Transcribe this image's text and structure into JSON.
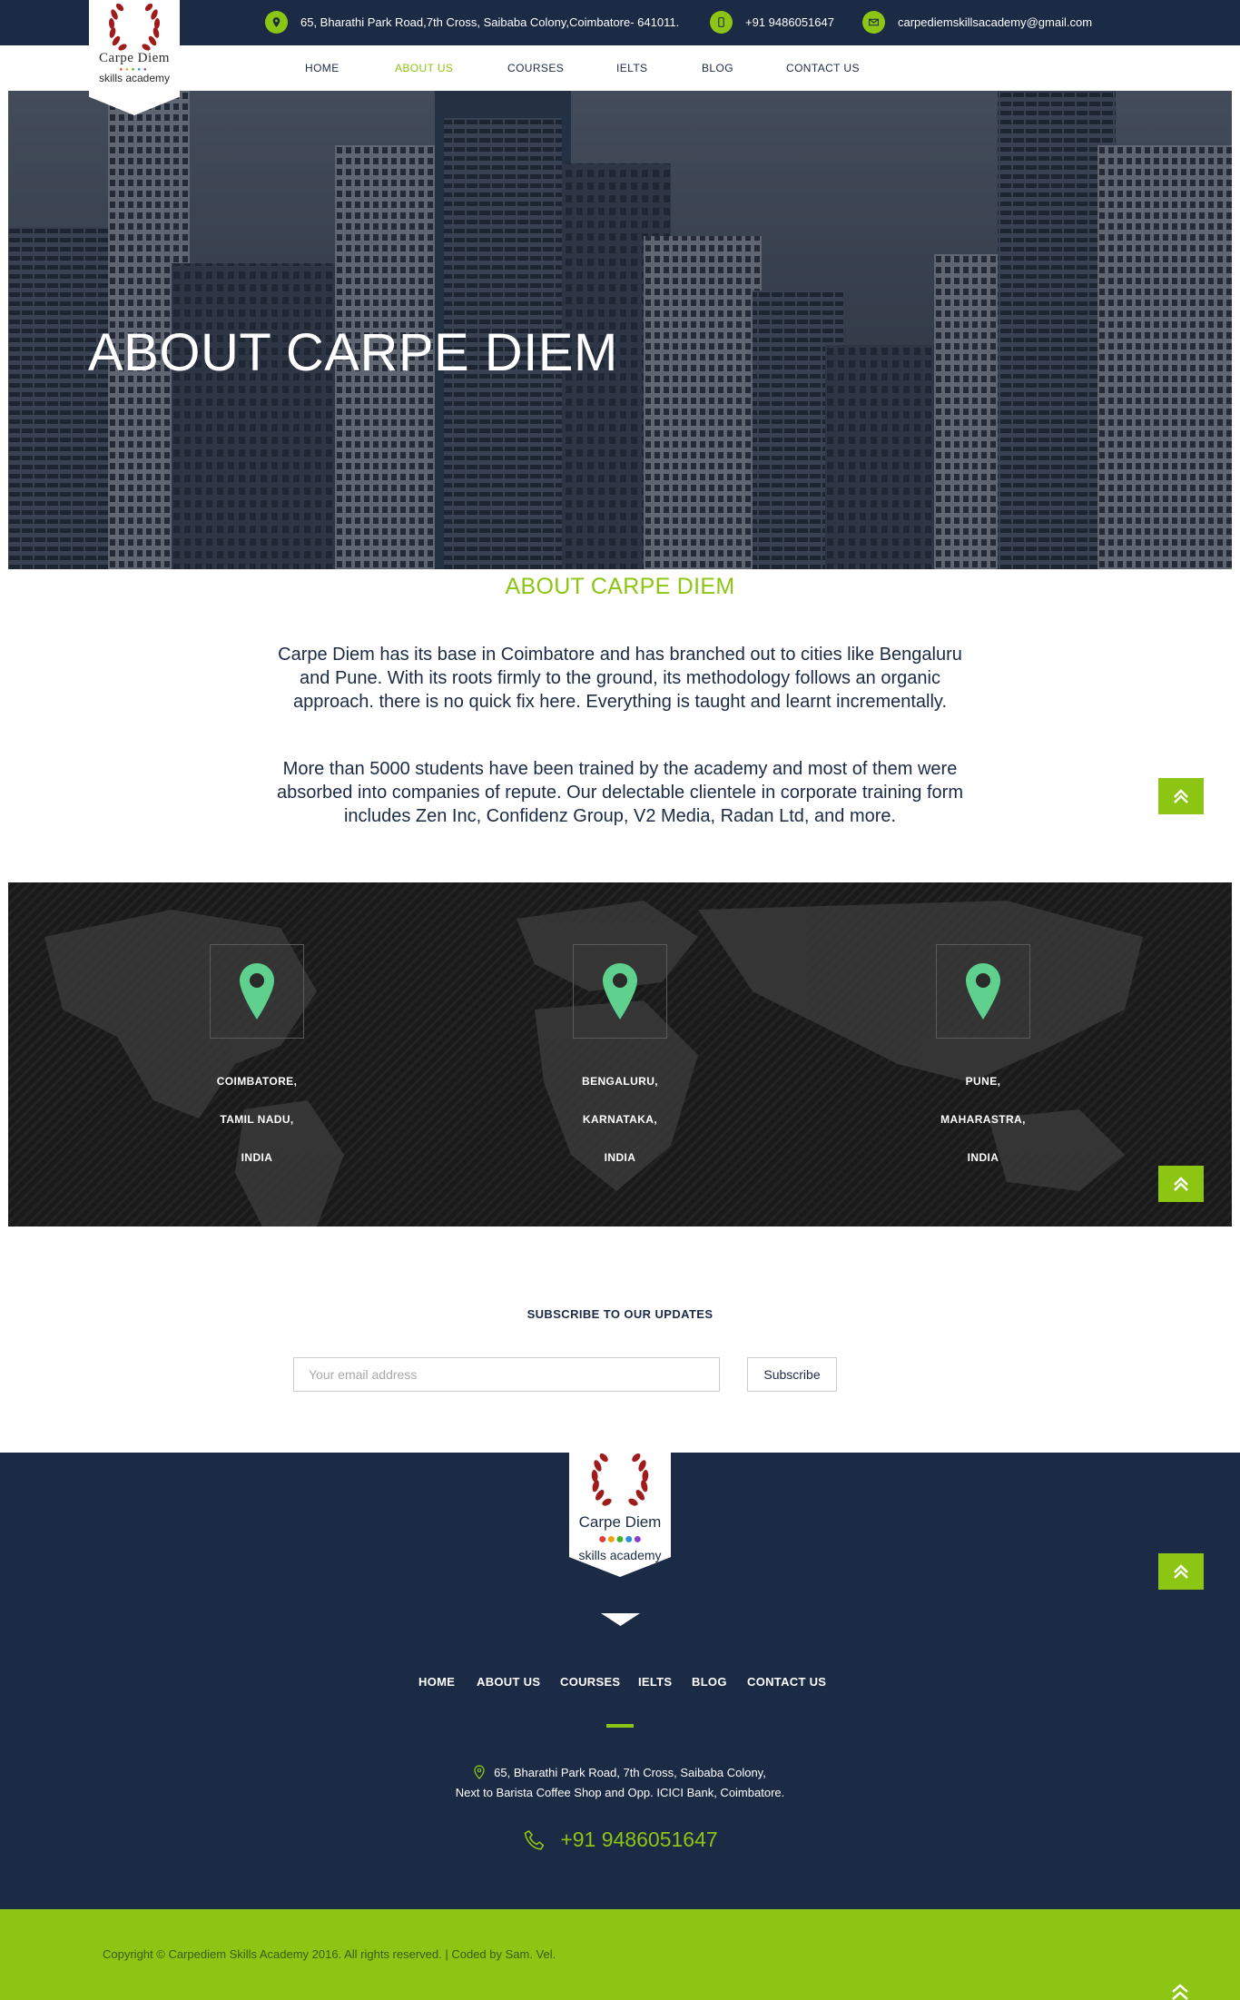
{
  "topbar": {
    "address": "65, Bharathi Park Road,7th Cross, Saibaba Colony,Coimbatore- 641011.",
    "phone": "+91 9486051647",
    "email": "carpediemskillsacademy@gmail.com",
    "icons": [
      "map-pin-icon",
      "phone-icon",
      "mail-icon"
    ]
  },
  "logo": {
    "brand": "Carpe Diem",
    "tagline": "skills academy"
  },
  "nav": {
    "items": [
      "HOME",
      "ABOUT US",
      "COURSES",
      "IELTS",
      "BLOG",
      "CONTACT US"
    ],
    "active": "ABOUT US"
  },
  "hero": {
    "title": "ABOUT CARPE DIEM"
  },
  "about": {
    "title": "ABOUT CARPE DIEM",
    "paragraphs": [
      "Carpe Diem has its base in Coimbatore and has branched out to cities like Bengaluru and Pune. With its roots firmly to the ground, its methodology follows an organic approach. there is no quick fix here. Everything is taught and learnt incrementally.",
      "More than 5000 students have been trained by the academy and most of them were absorbed into companies of repute. Our delectable clientele in corporate training form includes Zen Inc, Confidenz Group, V2 Media, Radan Ltd, and more."
    ]
  },
  "locations": [
    {
      "city": "COIMBATORE,",
      "state": "TAMIL NADU,",
      "country": "INDIA"
    },
    {
      "city": "BENGALURU,",
      "state": "KARNATAKA,",
      "country": "INDIA"
    },
    {
      "city": "PUNE,",
      "state": "MAHARASTRA,",
      "country": "INDIA"
    }
  ],
  "subscribe": {
    "title": "SUBSCRIBE TO OUR UPDATES",
    "placeholder": "Your email address",
    "button": "Subscribe"
  },
  "footer": {
    "nav": [
      "HOME",
      "ABOUT US",
      "COURSES",
      "IELTS",
      "BLOG",
      "CONTACT US"
    ],
    "address_line1": "65, Bharathi Park Road, 7th Cross, Saibaba Colony,",
    "address_line2": "Next to Barista Coffee Shop and Opp. ICICI Bank, Coimbatore.",
    "phone": "+91 9486051647",
    "copyright": "Copyright © Carpediem Skills Academy 2016. All rights reserved. | Coded by Sam. Vel."
  },
  "colors": {
    "navy": "#1b2a45",
    "lime": "#8cc513",
    "pin_green": "#5fd08e",
    "logo_red": "#a01c1c"
  }
}
